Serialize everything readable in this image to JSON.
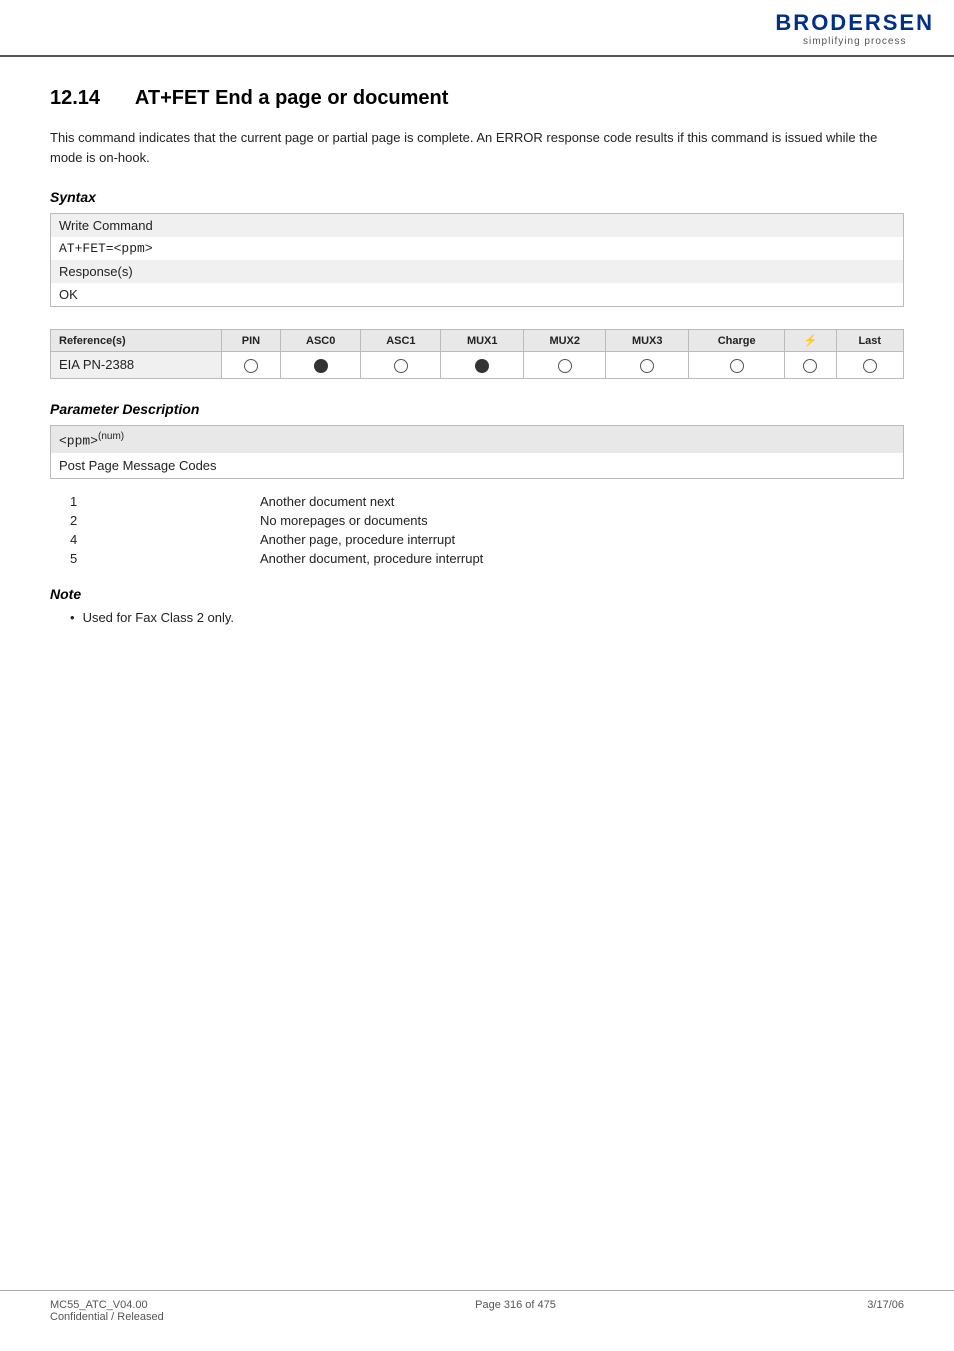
{
  "header": {
    "logo_name": "BRODERSEN",
    "logo_sub": "simplifying process"
  },
  "section": {
    "number": "12.14",
    "title": "AT+FET   End a page or document"
  },
  "intro": "This command indicates that the current page or partial page is complete. An ERROR response code results if this command is issued while the mode is on-hook.",
  "syntax": {
    "heading": "Syntax",
    "rows": [
      {
        "label": "Write Command",
        "mono": false
      },
      {
        "label": "AT+FET=<ppm>",
        "mono": true
      },
      {
        "label": "Response(s)",
        "mono": false
      },
      {
        "label": "OK",
        "mono": false
      }
    ]
  },
  "reference_table": {
    "columns": [
      "Reference(s)",
      "PIN",
      "ASC0",
      "ASC1",
      "MUX1",
      "MUX2",
      "MUX3",
      "Charge",
      "⚡",
      "Last"
    ],
    "rows": [
      {
        "name": "EIA PN-2388",
        "pin": "empty",
        "asc0": "filled",
        "asc1": "empty",
        "mux1": "filled",
        "mux2": "empty",
        "mux3": "empty",
        "charge": "empty",
        "special": "empty",
        "last": "empty"
      }
    ]
  },
  "parameter_description": {
    "heading": "Parameter Description",
    "param_label": "<ppm>",
    "param_sup": "(num)",
    "param_desc": "Post Page Message Codes",
    "values": [
      {
        "num": "1",
        "desc": "Another document next"
      },
      {
        "num": "2",
        "desc": "No morepages or documents"
      },
      {
        "num": "4",
        "desc": "Another page, procedure interrupt"
      },
      {
        "num": "5",
        "desc": "Another document, procedure interrupt"
      }
    ]
  },
  "note": {
    "heading": "Note",
    "items": [
      "Used for Fax Class 2 only."
    ]
  },
  "footer": {
    "left_line1": "MC55_ATC_V04.00",
    "left_line2": "Confidential / Released",
    "center": "Page 316 of 475",
    "right": "3/17/06"
  }
}
